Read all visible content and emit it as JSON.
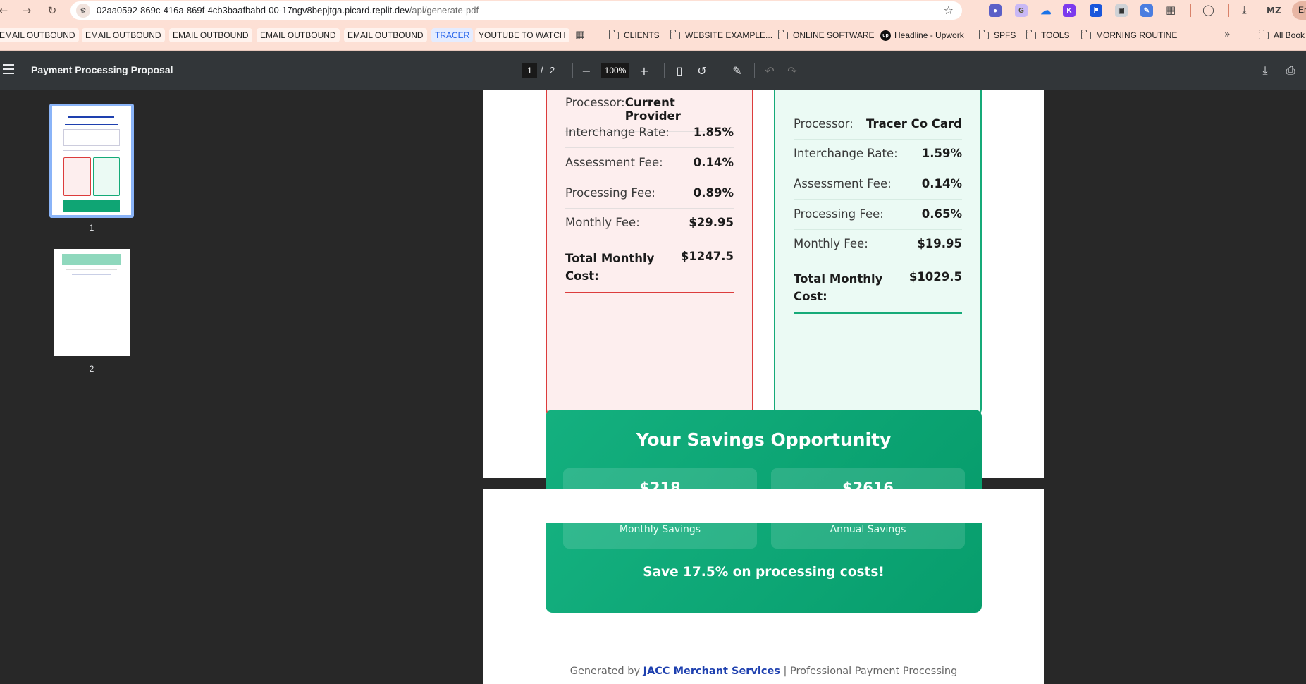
{
  "browser": {
    "url_host": "02aa0592-869c-416a-869f-4cb3baafbabd-00-17ngv8bepjtga.picard.replit.dev",
    "url_path": "/api/generate-pdf",
    "profile_label": "Er",
    "bookmarks": [
      {
        "label": "EMAIL OUTBOUND",
        "kind": "pill"
      },
      {
        "label": "EMAIL OUTBOUND",
        "kind": "pill"
      },
      {
        "label": "EMAIL OUTBOUND",
        "kind": "pill"
      },
      {
        "label": "EMAIL OUTBOUND",
        "kind": "pill"
      },
      {
        "label": "EMAIL OUTBOUND",
        "kind": "pill"
      },
      {
        "label": "TRACER",
        "kind": "pill"
      },
      {
        "label": "YOUTUBE TO WATCH",
        "kind": "pill"
      },
      {
        "label": "CLIENTS",
        "kind": "folder"
      },
      {
        "label": "WEBSITE EXAMPLE...",
        "kind": "folder"
      },
      {
        "label": "ONLINE SOFTWARE",
        "kind": "folder"
      },
      {
        "label": "Headline - Upwork",
        "kind": "upwork"
      },
      {
        "label": "SPFS",
        "kind": "folder"
      },
      {
        "label": "TOOLS",
        "kind": "folder"
      },
      {
        "label": "MORNING ROUTINE",
        "kind": "folder"
      },
      {
        "label": "All Book",
        "kind": "folder"
      }
    ]
  },
  "viewer": {
    "title": "Payment Processing Proposal",
    "current_page": "1",
    "page_sep": "/",
    "total_pages": "2",
    "zoom": "100%",
    "thumbnails": [
      "1",
      "2"
    ]
  },
  "current_card": {
    "rows": [
      {
        "label": "Processor:",
        "value": "Current Provider"
      },
      {
        "label": "Interchange Rate:",
        "value": "1.85%"
      },
      {
        "label": "Assessment Fee:",
        "value": "0.14%"
      },
      {
        "label": "Processing Fee:",
        "value": "0.89%"
      },
      {
        "label": "Monthly Fee:",
        "value": "$29.95"
      }
    ],
    "total_label": "Total Monthly Cost:",
    "total_value": "$1247.5"
  },
  "tracer_card": {
    "rows": [
      {
        "label": "Processor:",
        "value": "Tracer Co Card"
      },
      {
        "label": "Interchange Rate:",
        "value": "1.59%"
      },
      {
        "label": "Assessment Fee:",
        "value": "0.14%"
      },
      {
        "label": "Processing Fee:",
        "value": "0.65%"
      },
      {
        "label": "Monthly Fee:",
        "value": "$19.95"
      }
    ],
    "total_label": "Total Monthly Cost:",
    "total_value": "$1029.5"
  },
  "savings": {
    "title": "Your Savings Opportunity",
    "monthly_value": "$218",
    "annual_value": "$2616",
    "monthly_label": "Monthly Savings",
    "annual_label": "Annual Savings",
    "summary": "Save 17.5% on processing costs!"
  },
  "footer": {
    "prefix": "Generated by",
    "brand": "JACC Merchant Services",
    "suffix": "| Professional Payment Processing"
  },
  "colors": {
    "current_accent": "#dc3c3c",
    "tracer_accent": "#15aa78",
    "savings_bg": "#0fa574",
    "brand_blue": "#1e40af"
  }
}
